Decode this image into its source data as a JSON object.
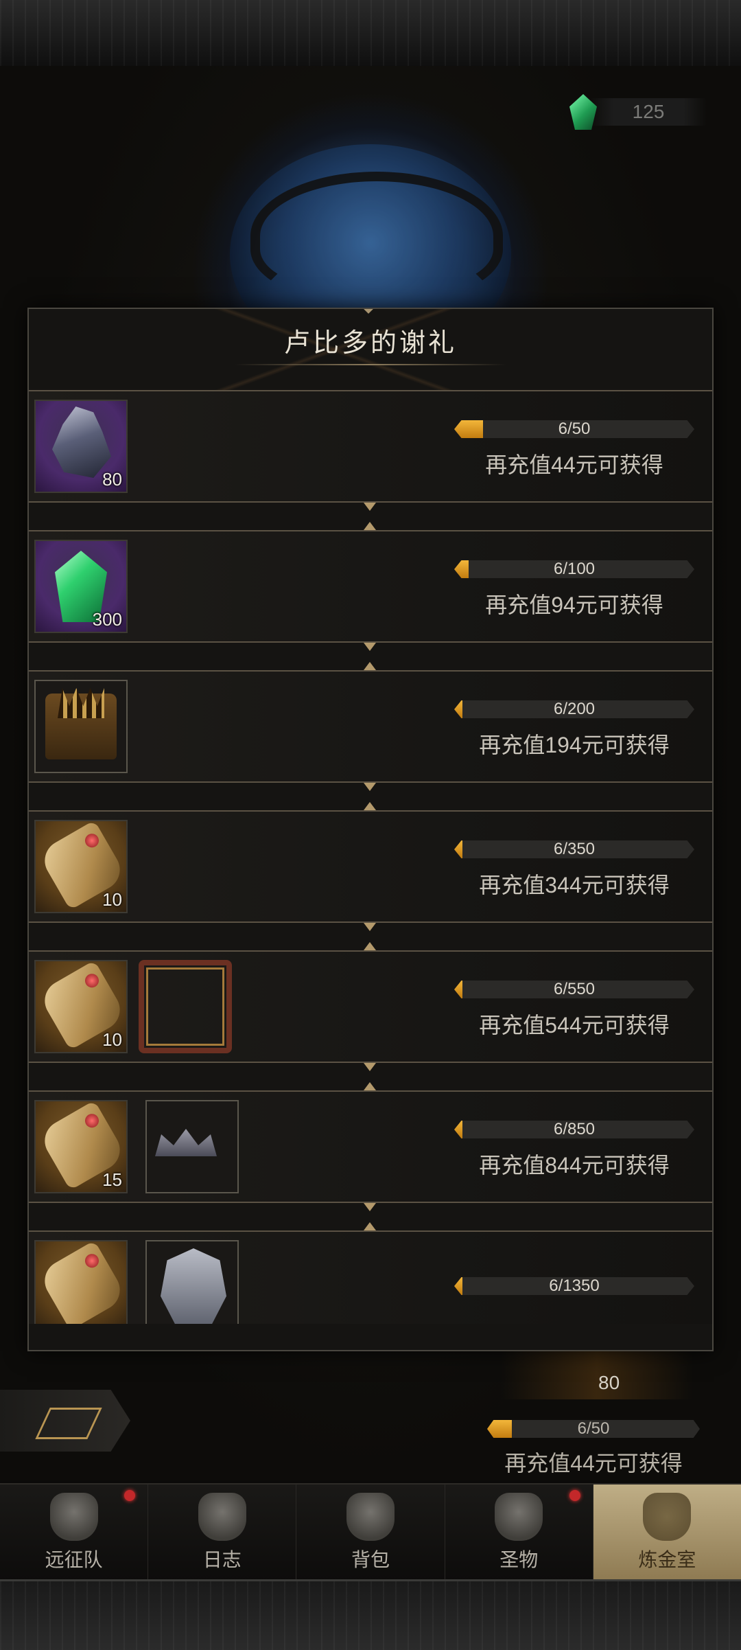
{
  "currency": {
    "icon": "green-gem-icon",
    "amount": "125"
  },
  "modal": {
    "title": "卢比多的谢礼",
    "rows": [
      {
        "items": [
          {
            "icon": "ore-icon",
            "style": "purple",
            "count": "80"
          }
        ],
        "progress": {
          "text": "6/50",
          "current": 6,
          "target": 50
        },
        "hint": "再充值44元可获得"
      },
      {
        "items": [
          {
            "icon": "green-gem-icon",
            "style": "purple",
            "count": "300"
          }
        ],
        "progress": {
          "text": "6/100",
          "current": 6,
          "target": 100
        },
        "hint": "再充值94元可获得"
      },
      {
        "items": [
          {
            "icon": "treasure-chest-icon",
            "style": "dark",
            "count": ""
          }
        ],
        "progress": {
          "text": "6/200",
          "current": 6,
          "target": 200
        },
        "hint": "再充值194元可获得"
      },
      {
        "items": [
          {
            "icon": "scroll-icon",
            "style": "gold",
            "count": "10"
          }
        ],
        "progress": {
          "text": "6/350",
          "current": 6,
          "target": 350
        },
        "hint": "再充值344元可获得"
      },
      {
        "items": [
          {
            "icon": "scroll-icon",
            "style": "gold",
            "count": "10"
          },
          {
            "icon": "portrait-frame-icon",
            "style": "frame",
            "count": ""
          }
        ],
        "progress": {
          "text": "6/550",
          "current": 6,
          "target": 550
        },
        "hint": "再充值544元可获得"
      },
      {
        "items": [
          {
            "icon": "scroll-icon",
            "style": "gold",
            "count": "15"
          },
          {
            "icon": "crown-icon",
            "style": "dark",
            "count": ""
          }
        ],
        "progress": {
          "text": "6/850",
          "current": 6,
          "target": 850
        },
        "hint": "再充值844元可获得"
      },
      {
        "items": [
          {
            "icon": "scroll-icon",
            "style": "gold",
            "count": ""
          },
          {
            "icon": "helmet-icon",
            "style": "dark",
            "count": ""
          }
        ],
        "progress": {
          "text": "6/1350",
          "current": 6,
          "target": 1350
        },
        "hint": ""
      }
    ]
  },
  "background_panel": {
    "item_count": "80",
    "progress_text": "6/50",
    "hint": "再充值44元可获得"
  },
  "nav": [
    {
      "label": "远征队",
      "icon": "viking-helmet-icon",
      "badge": true,
      "active": false
    },
    {
      "label": "日志",
      "icon": "journal-icon",
      "badge": false,
      "active": false
    },
    {
      "label": "背包",
      "icon": "backpack-icon",
      "badge": false,
      "active": false
    },
    {
      "label": "圣物",
      "icon": "relic-icon",
      "badge": true,
      "active": false
    },
    {
      "label": "炼金室",
      "icon": "alchemy-icon",
      "badge": false,
      "active": true
    }
  ],
  "colors": {
    "accent": "#c27c10",
    "badge": "#c3282a",
    "frame": "#5b5244"
  }
}
